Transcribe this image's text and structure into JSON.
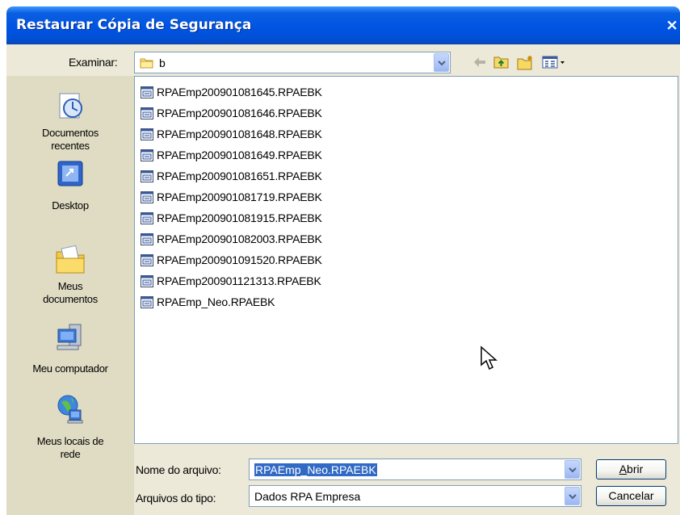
{
  "window": {
    "title": "Restaurar Cópia de Segurança",
    "close_symbol": "×"
  },
  "lookin": {
    "label": "Examinar:",
    "value": "b"
  },
  "places": [
    {
      "name": "places-recent",
      "icon": "recent-documents-icon",
      "label_lines": [
        "Documentos",
        "recentes"
      ]
    },
    {
      "name": "places-desktop",
      "icon": "desktop-icon",
      "label_lines": [
        "Desktop"
      ]
    },
    {
      "name": "places-my-documents",
      "icon": "my-documents-icon",
      "label_lines": [
        "Meus",
        "documentos"
      ]
    },
    {
      "name": "places-my-computer",
      "icon": "my-computer-icon",
      "label_lines": [
        "Meu computador"
      ]
    },
    {
      "name": "places-network",
      "icon": "network-places-icon",
      "label_lines": [
        "Meus locais de",
        "rede"
      ]
    }
  ],
  "files": [
    "RPAEmp200901081645.RPAEBK",
    "RPAEmp200901081646.RPAEBK",
    "RPAEmp200901081648.RPAEBK",
    "RPAEmp200901081649.RPAEBK",
    "RPAEmp200901081651.RPAEBK",
    "RPAEmp200901081719.RPAEBK",
    "RPAEmp200901081915.RPAEBK",
    "RPAEmp200901082003.RPAEBK",
    "RPAEmp200901091520.RPAEBK",
    "RPAEmp200901121313.RPAEBK",
    "RPAEmp_Neo.RPAEBK"
  ],
  "filename": {
    "label": "Nome do arquivo:",
    "value": "RPAEmp_Neo.RPAEBK"
  },
  "filetype": {
    "label": "Arquivos do tipo:",
    "value": "Dados RPA Empresa"
  },
  "buttons": {
    "open": "Abrir",
    "open_mnemonic": "A",
    "open_rest": "brir",
    "cancel": "Cancelar"
  },
  "colors": {
    "titlebar": "#0054e3",
    "dialog_bg": "#ece9d8",
    "places_bg": "#dfdcc3",
    "selection": "#316ac5"
  }
}
